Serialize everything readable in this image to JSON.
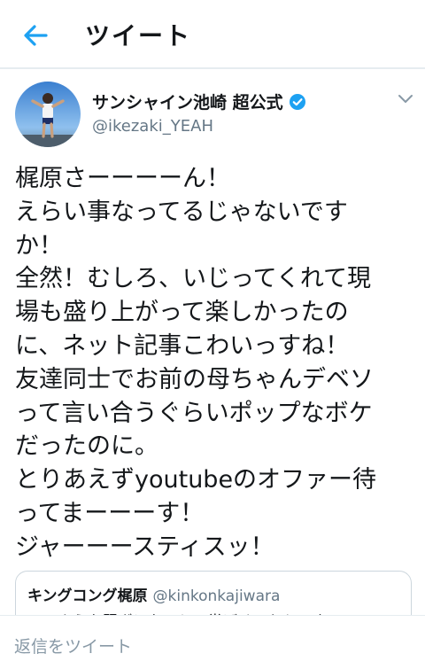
{
  "header": {
    "title": "ツイート",
    "back_icon": "back-arrow-icon",
    "accent": "#1da1f2"
  },
  "tweet": {
    "author_name": "サンシャイン池崎 超公式",
    "author_handle": "@ikezaki_YEAH",
    "verified_icon": "verified-badge-icon",
    "menu_icon": "chevron-down-icon",
    "text": "梶原さーーーーん！\nえらい事なってるじゃないです\nか！\n全然！むしろ、いじってくれて現\n場も盛り上がって楽しかったの\nに、ネット記事こわいっすね！\n友達同士でお前の母ちゃんデベソ\nって言い合うぐらいポップなボケ\nだったのに。\nとりあえずyoutubeのオファー待\nってまーーーす！\nジャーーースティスッ！"
  },
  "quote": {
    "author_name": "キングコング梶原",
    "author_handle": "@kinkonkajiwara",
    "text": "このような騒ぎになると、党ばせてもらいま!"
  },
  "reply": {
    "placeholder": "返信をツイート"
  }
}
